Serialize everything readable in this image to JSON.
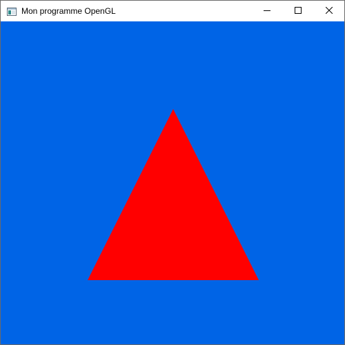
{
  "window": {
    "title": "Mon programme OpenGL",
    "icon": "app-window-icon",
    "controls": {
      "minimize_icon": "minimize-icon",
      "maximize_icon": "maximize-icon",
      "close_icon": "close-icon"
    }
  },
  "scene": {
    "clear_color": "#0064e6",
    "triangle": {
      "fill": "#ff0000"
    }
  }
}
